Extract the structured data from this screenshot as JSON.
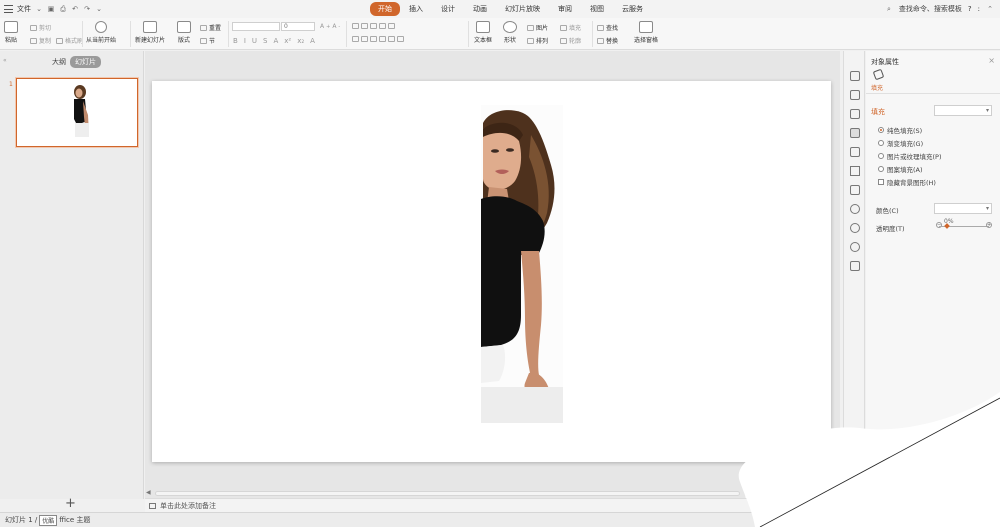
{
  "titlebar": {
    "file_label": "文件",
    "tabs": [
      {
        "label": "开始",
        "active": true
      },
      {
        "label": "插入",
        "active": false
      },
      {
        "label": "设计",
        "active": false
      },
      {
        "label": "动画",
        "active": false
      },
      {
        "label": "幻灯片放映",
        "active": false
      },
      {
        "label": "审阅",
        "active": false
      },
      {
        "label": "视图",
        "active": false
      },
      {
        "label": "云服务",
        "active": false
      }
    ],
    "search_label": "查找命令、搜索模板",
    "help": "?",
    "more": ":"
  },
  "ribbon": {
    "paste": "粘贴",
    "cut": "剪切",
    "copy": "复制",
    "format_painter": "格式刷",
    "from_current": "从当前开始",
    "new_slide": "新建幻灯片",
    "layout": "版式",
    "reset": "重置",
    "section": "节",
    "font_size": "0",
    "format_buttons": [
      "B",
      "I",
      "U",
      "S",
      "A",
      "x²",
      "x₂",
      "A"
    ],
    "textbox": "文本框",
    "shape": "形状",
    "picture": "图片",
    "fill": "填充",
    "arrange": "排列",
    "outline": "轮廓",
    "find": "查找",
    "replace": "替换",
    "select_pane": "选择窗格"
  },
  "leftpanel": {
    "outline_tab": "大纲",
    "slides_tab": "幻灯片",
    "slide_number": "1",
    "add_slide": "+"
  },
  "props": {
    "title": "对象属性",
    "fill_tab": "填充",
    "section_fill": "填充",
    "options": [
      {
        "label": "纯色填充(S)",
        "type": "radio",
        "selected": true
      },
      {
        "label": "渐变填充(G)",
        "type": "radio",
        "selected": false
      },
      {
        "label": "图片或纹理填充(P)",
        "type": "radio",
        "selected": false
      },
      {
        "label": "图案填充(A)",
        "type": "radio",
        "selected": false
      },
      {
        "label": "隐藏背景图形(H)",
        "type": "checkbox",
        "selected": false
      }
    ],
    "color_label": "颜色(C)",
    "transparency_label": "透明度(T)",
    "transparency_value": "0%",
    "transparency_fraction": 0.0
  },
  "notes": {
    "placeholder": "单击此处添加备注"
  },
  "status": {
    "slide_info": "幻灯片 1 /",
    "theme_box": "优酷",
    "theme_name": "ffice 主题"
  },
  "colors": {
    "accent": "#d0662b",
    "slide_bg": "#ffffff",
    "workspace": "#e6e6e6"
  }
}
